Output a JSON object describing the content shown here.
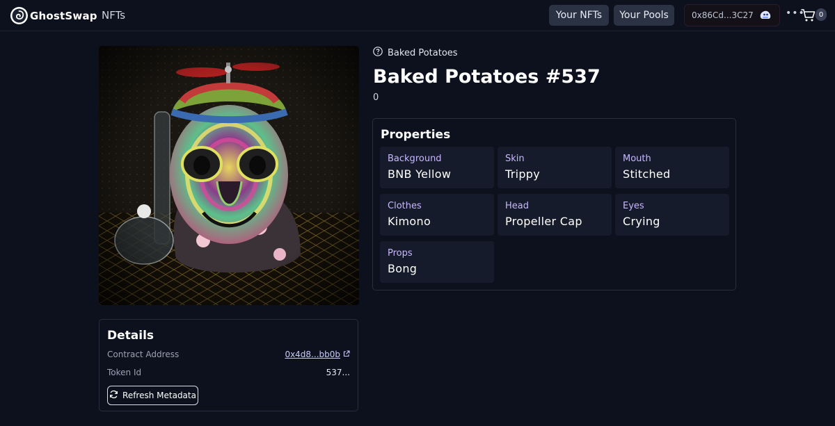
{
  "header": {
    "brand_name": "GhostSwap",
    "nav_nfts": "NFTs",
    "your_nfts_label": "Your NFTs",
    "your_pools_label": "Your Pools",
    "wallet_address": "0x86Cd...3C27",
    "more_label": "•••",
    "cart_count": "0"
  },
  "nft": {
    "collection_name": "Baked Potatoes",
    "title": "Baked Potatoes #537",
    "price": "0",
    "image_alt": "Baked Potatoes #537 artwork"
  },
  "details": {
    "title": "Details",
    "contract_label": "Contract Address",
    "contract_value": "0x4d8...bb0b",
    "token_label": "Token Id",
    "token_value": "537...",
    "refresh_label": "Refresh Metadata"
  },
  "properties": {
    "title": "Properties",
    "items": [
      {
        "trait": "Background",
        "value": "BNB Yellow"
      },
      {
        "trait": "Skin",
        "value": "Trippy"
      },
      {
        "trait": "Mouth",
        "value": "Stitched"
      },
      {
        "trait": "Clothes",
        "value": "Kimono"
      },
      {
        "trait": "Head",
        "value": "Propeller Cap"
      },
      {
        "trait": "Eyes",
        "value": "Crying"
      },
      {
        "trait": "Props",
        "value": "Bong"
      }
    ]
  },
  "colors": {
    "background": "#0c111d",
    "card_border": "#262e3f",
    "trait_tile": "#151b2a",
    "trait_label": "#c9b8ff",
    "button_bg": "#2b3244"
  }
}
